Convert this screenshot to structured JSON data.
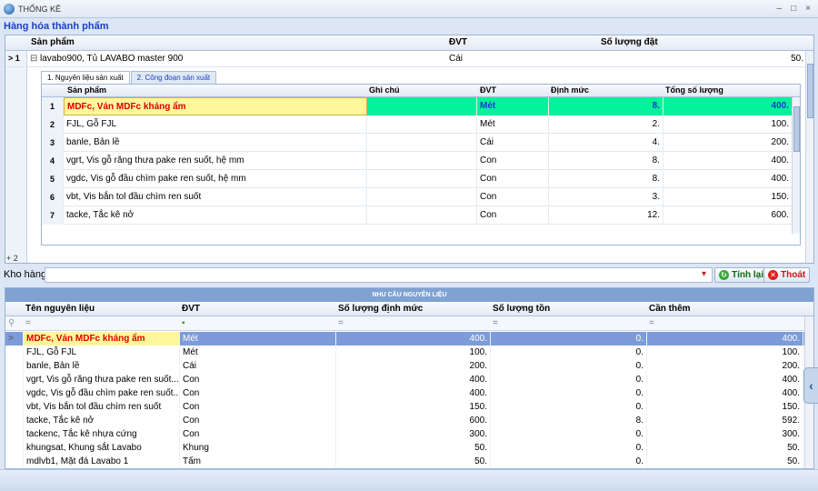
{
  "window": {
    "title": "THỐNG KÊ",
    "controls": [
      "–",
      "□",
      "×"
    ]
  },
  "section_title": "Hàng hóa thành phẩm",
  "product_grid": {
    "columns": [
      "Sản phẩm",
      "ĐVT",
      "Số lượng đặt"
    ],
    "row1": {
      "indicator": "> 1",
      "expander": "⊟",
      "name": "lavabo900, Tủ LAVABO master 900",
      "unit": "Cái",
      "qty": "50."
    },
    "row2_indicator": "+ 2"
  },
  "tabs": [
    "1. Nguyên liệu sản xuất",
    "2. Công đoạn sản xuất"
  ],
  "materials_grid": {
    "columns": [
      "Sản phẩm",
      "Ghi chú",
      "ĐVT",
      "Định mức",
      "Tổng số lượng"
    ],
    "rows": [
      {
        "no": "1",
        "name": "MDFc, Ván MDFc kháng ẩm",
        "note": "",
        "unit": "Mét",
        "norm": "8.",
        "total": "400."
      },
      {
        "no": "2",
        "name": "FJL, Gỗ FJL",
        "note": "",
        "unit": "Mét",
        "norm": "2.",
        "total": "100."
      },
      {
        "no": "3",
        "name": "banle, Bản lề",
        "note": "",
        "unit": "Cái",
        "norm": "4.",
        "total": "200."
      },
      {
        "no": "4",
        "name": "vgrt, Vis gỗ răng thưa pake ren suốt, hệ mm",
        "note": "",
        "unit": "Con",
        "norm": "8.",
        "total": "400."
      },
      {
        "no": "5",
        "name": "vgdc, Vis gỗ đầu chìm pake ren suốt, hệ mm",
        "note": "",
        "unit": "Con",
        "norm": "8.",
        "total": "400."
      },
      {
        "no": "6",
        "name": "vbt, Vis bắn tol đầu chìm ren suốt",
        "note": "",
        "unit": "Con",
        "norm": "3.",
        "total": "150."
      },
      {
        "no": "7",
        "name": "tacke, Tắc kê nở",
        "note": "",
        "unit": "Con",
        "norm": "12.",
        "total": "600."
      }
    ]
  },
  "warehouse": {
    "label": "Kho hàng",
    "value": "",
    "recalc_label": "Tính lại",
    "exit_label": "Thoát"
  },
  "needs_grid": {
    "band_title": "NHU CẦU NGUYÊN LIỆU",
    "columns": [
      "Tên nguyên liệu",
      "ĐVT",
      "Số lượng định mức",
      "Số lượng tồn",
      "Cần thêm"
    ],
    "filter_symbols": [
      "=",
      "▪",
      "=",
      "=",
      "="
    ],
    "rows": [
      {
        "name": "MDFc, Ván MDFc kháng ẩm",
        "unit": "Mét",
        "norm_qty": "400.",
        "stock": "0.",
        "need": "400."
      },
      {
        "name": "FJL, Gỗ FJL",
        "unit": "Mét",
        "norm_qty": "100.",
        "stock": "0.",
        "need": "100."
      },
      {
        "name": "banle, Bản lề",
        "unit": "Cái",
        "norm_qty": "200.",
        "stock": "0.",
        "need": "200."
      },
      {
        "name": "vgrt, Vis gỗ răng thưa pake ren suốt...",
        "unit": "Con",
        "norm_qty": "400.",
        "stock": "0.",
        "need": "400."
      },
      {
        "name": "vgdc, Vis gỗ đầu chìm pake ren suốt...",
        "unit": "Con",
        "norm_qty": "400.",
        "stock": "0.",
        "need": "400."
      },
      {
        "name": "vbt, Vis bắn tol đầu chìm ren suốt",
        "unit": "Con",
        "norm_qty": "150.",
        "stock": "0.",
        "need": "150."
      },
      {
        "name": "tacke, Tắc kê nở",
        "unit": "Con",
        "norm_qty": "600.",
        "stock": "8.",
        "need": "592."
      },
      {
        "name": "tackenc, Tắc kê nhựa cứng",
        "unit": "Con",
        "norm_qty": "300.",
        "stock": "0.",
        "need": "300."
      },
      {
        "name": "khungsat, Khung sắt Lavabo",
        "unit": "Khung",
        "norm_qty": "50.",
        "stock": "0.",
        "need": "50."
      },
      {
        "name": "mdlvb1, Mặt đá Lavabo 1",
        "unit": "Tấm",
        "norm_qty": "50.",
        "stock": "0.",
        "need": "50."
      }
    ]
  },
  "colors": {
    "accent": "#1a3dcc",
    "selected_row_bg": "#7d9bd8",
    "highlight_yellow": "#fff79a",
    "highlight_green": "#00f39a",
    "band": "#7fa2d2"
  }
}
